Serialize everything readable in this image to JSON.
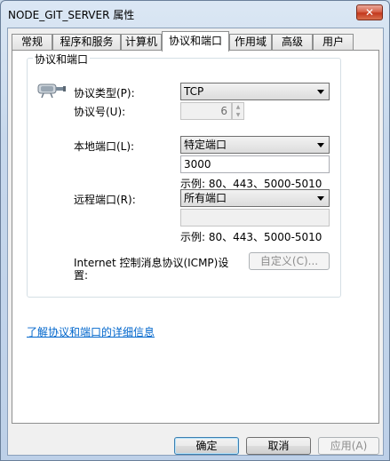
{
  "window": {
    "title": "NODE_GIT_SERVER 属性",
    "close_label": "✕"
  },
  "tabs": [
    {
      "label": "常规"
    },
    {
      "label": "程序和服务"
    },
    {
      "label": "计算机"
    },
    {
      "label": "协议和端口"
    },
    {
      "label": "作用域"
    },
    {
      "label": "高级"
    },
    {
      "label": "用户"
    }
  ],
  "active_tab": "协议和端口",
  "group": {
    "title": "协议和端口"
  },
  "protocol": {
    "type_label": "协议类型(P):",
    "type_value": "TCP",
    "number_label": "协议号(U):",
    "number_value": "6"
  },
  "local_port": {
    "label": "本地端口(L):",
    "selected": "特定端口",
    "value": "3000",
    "example": "示例: 80、443、5000-5010"
  },
  "remote_port": {
    "label": "远程端口(R):",
    "selected": "所有端口",
    "value": "",
    "example": "示例: 80、443、5000-5010"
  },
  "icmp": {
    "label_line1": "Internet 控制消息协议(ICMP)设",
    "label_line2": "置:",
    "button": "自定义(C)..."
  },
  "learn_more_link": "了解协议和端口的详细信息",
  "footer": {
    "ok": "确定",
    "cancel": "取消",
    "apply": "应用(A)"
  }
}
